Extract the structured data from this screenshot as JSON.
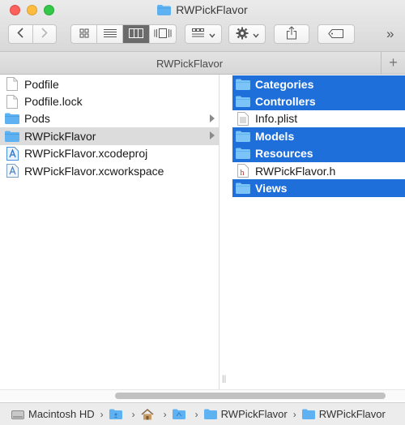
{
  "window": {
    "title": "RWPickFlavor"
  },
  "toolbar": {
    "back_icon": "chevron-left-icon",
    "forward_icon": "chevron-right-icon",
    "view_modes": [
      "icon-view-icon",
      "list-view-icon",
      "column-view-icon",
      "cover-flow-icon"
    ],
    "active_view": "column-view-icon",
    "overflow_label": "»"
  },
  "pathbar": {
    "label": "RWPickFlavor",
    "add_label": "+"
  },
  "column1": {
    "items": [
      {
        "name": "Podfile",
        "icon": "document-icon"
      },
      {
        "name": "Podfile.lock",
        "icon": "document-icon"
      },
      {
        "name": "Pods",
        "icon": "folder-icon"
      },
      {
        "name": "RWPickFlavor",
        "icon": "folder-icon"
      },
      {
        "name": "RWPickFlavor.xcodeproj",
        "icon": "xcodeproj-icon"
      },
      {
        "name": "RWPickFlavor.xcworkspace",
        "icon": "xcworkspace-icon"
      }
    ]
  },
  "column2": {
    "items": [
      {
        "name": "Categories",
        "icon": "folder-icon"
      },
      {
        "name": "Controllers",
        "icon": "folder-icon"
      },
      {
        "name": "Info.plist",
        "icon": "plist-icon"
      },
      {
        "name": "Models",
        "icon": "folder-icon"
      },
      {
        "name": "Resources",
        "icon": "folder-icon"
      },
      {
        "name": "RWPickFlavor.h",
        "icon": "header-file-icon"
      },
      {
        "name": "Views",
        "icon": "folder-icon"
      }
    ]
  },
  "statusbar": {
    "crumbs": [
      {
        "label": "Macintosh HD",
        "icon": "hard-drive-icon"
      },
      {
        "label": "",
        "icon": "user-folder-icon"
      },
      {
        "label": "",
        "icon": "home-icon"
      },
      {
        "label": "",
        "icon": "folder-icon"
      },
      {
        "label": "RWPickFlavor",
        "icon": "folder-icon"
      },
      {
        "label": "RWPickFlavor",
        "icon": "folder-icon"
      }
    ]
  },
  "colors": {
    "selection_blue": "#1e6fd9",
    "folder_blue": "#5eb2f1"
  }
}
